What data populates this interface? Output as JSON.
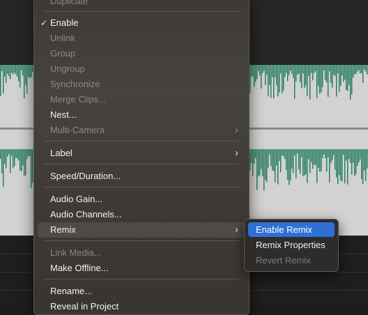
{
  "menu": {
    "items": [
      {
        "label": "Duplicate",
        "enabled": false
      },
      {
        "label": "Enable",
        "enabled": true,
        "checked": true
      },
      {
        "label": "Unlink",
        "enabled": false
      },
      {
        "label": "Group",
        "enabled": false
      },
      {
        "label": "Ungroup",
        "enabled": false
      },
      {
        "label": "Synchronize",
        "enabled": false
      },
      {
        "label": "Merge Clips...",
        "enabled": false
      },
      {
        "label": "Nest...",
        "enabled": true
      },
      {
        "label": "Multi-Camera",
        "enabled": false,
        "submenu": true
      },
      {
        "label": "Label",
        "enabled": true,
        "submenu": true
      },
      {
        "label": "Speed/Duration...",
        "enabled": true
      },
      {
        "label": "Audio Gain...",
        "enabled": true
      },
      {
        "label": "Audio Channels...",
        "enabled": true
      },
      {
        "label": "Remix",
        "enabled": true,
        "submenu": true,
        "highlighted": true
      },
      {
        "label": "Link Media...",
        "enabled": false
      },
      {
        "label": "Make Offline...",
        "enabled": true
      },
      {
        "label": "Rename...",
        "enabled": true
      },
      {
        "label": "Reveal in Project",
        "enabled": true
      }
    ],
    "check_glyph": "✓",
    "arrow_glyph": "›"
  },
  "remix_submenu": {
    "items": [
      {
        "label": "Enable Remix",
        "enabled": true,
        "selected": true
      },
      {
        "label": "Remix Properties",
        "enabled": true
      },
      {
        "label": "Revert Remix",
        "enabled": false
      }
    ]
  },
  "colors": {
    "waveform": "#1f7a5a",
    "clip_background": "#d2d2d2",
    "selection_blue": "#2f6fd8"
  }
}
